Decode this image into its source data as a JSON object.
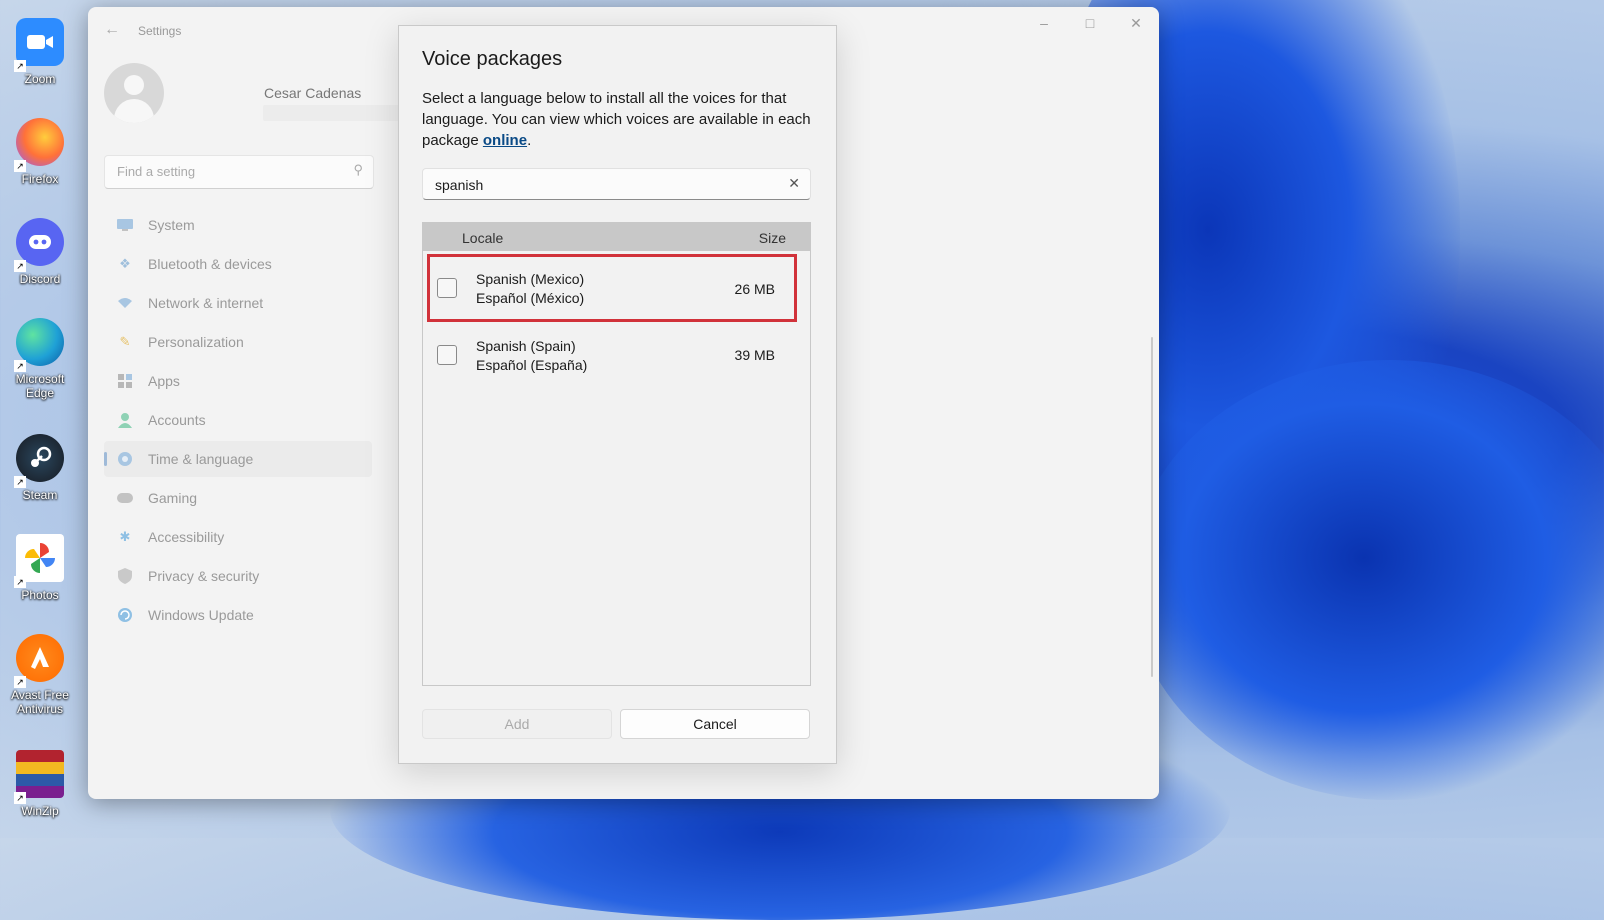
{
  "desktop": {
    "icons": [
      {
        "label": "Zoom",
        "icon": "zoom-icon",
        "color": "#2d8cff"
      },
      {
        "label": "Firefox",
        "icon": "firefox-icon",
        "color": "#ff7139"
      },
      {
        "label": "Discord",
        "icon": "discord-icon",
        "color": "#5865f2"
      },
      {
        "label": "Microsoft Edge",
        "icon": "edge-icon",
        "color": "#1fa1d6"
      },
      {
        "label": "Steam",
        "icon": "steam-icon",
        "color": "#1b2838"
      },
      {
        "label": "Photos",
        "icon": "photos-icon",
        "color": "#ffffff"
      },
      {
        "label": "Avast Free Antivirus",
        "icon": "avast-icon",
        "color": "#ff6a00"
      },
      {
        "label": "WinZip",
        "icon": "winzip-icon",
        "color": "#8b1f2a"
      }
    ]
  },
  "settings": {
    "app_title": "Settings",
    "user": {
      "name": "Cesar Cadenas"
    },
    "search_placeholder": "Find a setting",
    "nav": [
      {
        "label": "System",
        "icon": "monitor-icon",
        "active": false
      },
      {
        "label": "Bluetooth & devices",
        "icon": "bluetooth-icon",
        "active": false
      },
      {
        "label": "Network & internet",
        "icon": "wifi-icon",
        "active": false
      },
      {
        "label": "Personalization",
        "icon": "brush-icon",
        "active": false
      },
      {
        "label": "Apps",
        "icon": "apps-icon",
        "active": false
      },
      {
        "label": "Accounts",
        "icon": "person-icon",
        "active": false
      },
      {
        "label": "Time & language",
        "icon": "globe-clock-icon",
        "active": true
      },
      {
        "label": "Gaming",
        "icon": "gamepad-icon",
        "active": false
      },
      {
        "label": "Accessibility",
        "icon": "accessibility-icon",
        "active": false
      },
      {
        "label": "Privacy & security",
        "icon": "shield-icon",
        "active": false
      },
      {
        "label": "Windows Update",
        "icon": "update-icon",
        "active": false
      }
    ]
  },
  "dialog": {
    "title": "Voice packages",
    "description": "Select a language below to install all the voices for that language. You can view which voices are available in each package ",
    "link_text": "online",
    "description_end": ".",
    "search_value": "spanish",
    "columns": {
      "locale": "Locale",
      "size": "Size"
    },
    "rows": [
      {
        "name": "Spanish (Mexico)",
        "native": "Español (México)",
        "size": "26 MB",
        "checked": false,
        "highlighted": true
      },
      {
        "name": "Spanish (Spain)",
        "native": "Español (España)",
        "size": "39 MB",
        "checked": false,
        "highlighted": false
      }
    ],
    "add_label": "Add",
    "cancel_label": "Cancel",
    "highlight_color": "#d1323a"
  }
}
